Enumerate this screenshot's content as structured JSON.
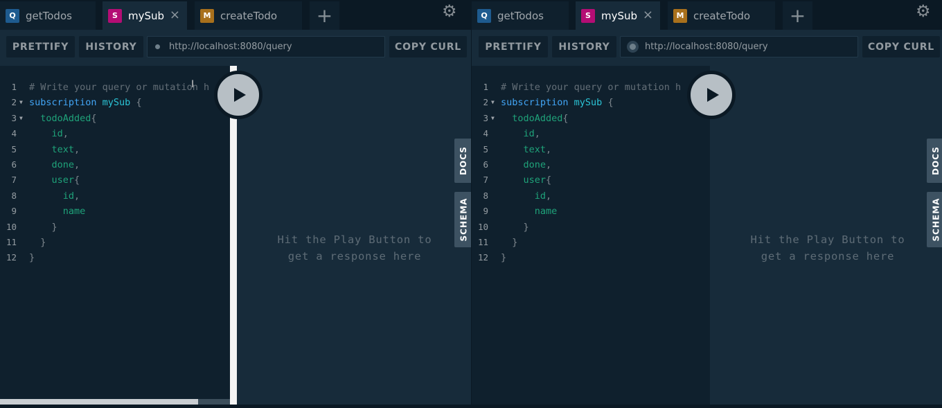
{
  "panes": [
    {
      "tabs": [
        {
          "badge": "Q",
          "label": "getTodos",
          "color": "#1e5b8f",
          "active": false
        },
        {
          "badge": "S",
          "label": "mySub",
          "color": "#b40d74",
          "active": true,
          "close": "×"
        },
        {
          "badge": "M",
          "label": "createTodo",
          "color": "#a8701c",
          "active": false
        }
      ],
      "add_tab": "+",
      "toolbar": {
        "prettify": "PRETTIFY",
        "history": "HISTORY",
        "url": "http://localhost:8080/query",
        "copy_curl": "COPY CURL"
      },
      "hint": "Hit the Play Button to get a response here",
      "docs": "DOCS",
      "schema": "SCHEMA"
    },
    {
      "tabs": [
        {
          "badge": "Q",
          "label": "getTodos",
          "color": "#1e5b8f",
          "active": false
        },
        {
          "badge": "S",
          "label": "mySub",
          "color": "#b40d74",
          "active": true,
          "close": "×"
        },
        {
          "badge": "M",
          "label": "createTodo",
          "color": "#a8701c",
          "active": false
        }
      ],
      "add_tab": "+",
      "toolbar": {
        "prettify": "PRETTIFY",
        "history": "HISTORY",
        "url": "http://localhost:8080/query",
        "copy_curl": "COPY CURL"
      },
      "hint": "Hit the Play Button to get a response here",
      "docs": "DOCS",
      "schema": "SCHEMA"
    }
  ],
  "code_lines": [
    {
      "n": "1",
      "fold": false,
      "parts": [
        [
          "c-com",
          "# Write your query or mutation h"
        ]
      ]
    },
    {
      "n": "2",
      "fold": true,
      "parts": [
        [
          "c-kw",
          "subscription "
        ],
        [
          "c-def",
          "mySub"
        ],
        [
          "c-punc",
          " {"
        ]
      ]
    },
    {
      "n": "3",
      "fold": true,
      "parts": [
        [
          "c-field",
          "  todoAdded"
        ],
        [
          "c-punc",
          "{"
        ]
      ]
    },
    {
      "n": "4",
      "fold": false,
      "parts": [
        [
          "c-field",
          "    id"
        ],
        [
          "c-punc",
          ","
        ]
      ]
    },
    {
      "n": "5",
      "fold": false,
      "parts": [
        [
          "c-field",
          "    text"
        ],
        [
          "c-punc",
          ","
        ]
      ]
    },
    {
      "n": "6",
      "fold": false,
      "parts": [
        [
          "c-field",
          "    done"
        ],
        [
          "c-punc",
          ","
        ]
      ]
    },
    {
      "n": "7",
      "fold": false,
      "parts": [
        [
          "c-field",
          "    user"
        ],
        [
          "c-punc",
          "{"
        ]
      ]
    },
    {
      "n": "8",
      "fold": false,
      "parts": [
        [
          "c-field",
          "      id"
        ],
        [
          "c-punc",
          ","
        ]
      ]
    },
    {
      "n": "9",
      "fold": false,
      "parts": [
        [
          "c-field",
          "      name"
        ]
      ]
    },
    {
      "n": "10",
      "fold": false,
      "parts": [
        [
          "c-punc",
          "    }"
        ]
      ]
    },
    {
      "n": "11",
      "fold": false,
      "parts": [
        [
          "c-punc",
          "  }"
        ]
      ]
    },
    {
      "n": "12",
      "fold": false,
      "parts": [
        [
          "c-punc",
          "}"
        ]
      ]
    }
  ],
  "icons": {
    "gear": "gear-icon",
    "play": "play-icon",
    "fold": "fold-arrow-icon"
  }
}
